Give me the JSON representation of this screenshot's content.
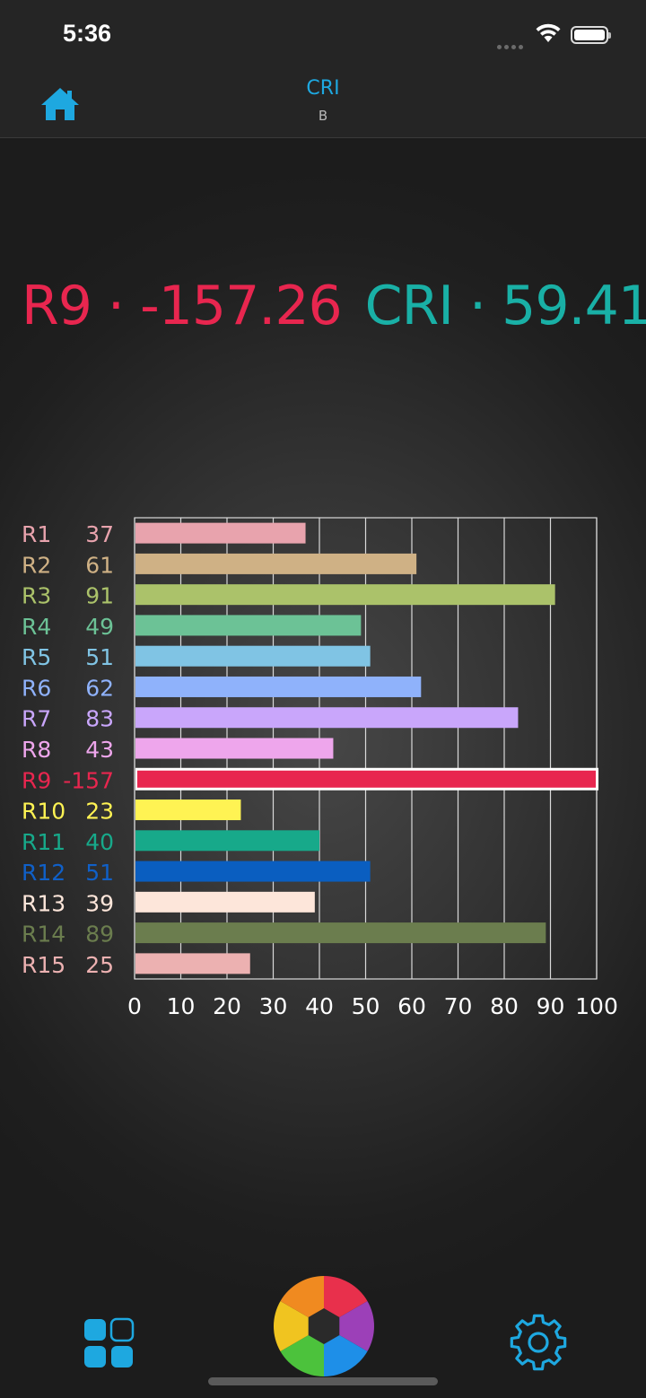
{
  "status_bar": {
    "time": "5:36"
  },
  "nav": {
    "title": "CRI",
    "subtitle": "B",
    "home_icon": "home-icon"
  },
  "headline": {
    "r9_text": "R9 · -157.26",
    "cri_text": "CRI · 59.41"
  },
  "chart_data": {
    "type": "bar",
    "orientation": "horizontal",
    "categories": [
      "R1",
      "R2",
      "R3",
      "R4",
      "R5",
      "R6",
      "R7",
      "R8",
      "R9",
      "R10",
      "R11",
      "R12",
      "R13",
      "R14",
      "R15"
    ],
    "value_labels": [
      "37",
      "61",
      "91",
      "49",
      "51",
      "62",
      "83",
      "43",
      "-157",
      "23",
      "40",
      "51",
      "39",
      "89",
      "25"
    ],
    "values": [
      37,
      61,
      91,
      49,
      51,
      62,
      83,
      43,
      -157,
      23,
      40,
      51,
      39,
      89,
      25
    ],
    "colors": [
      "#e8a3ad",
      "#cfb185",
      "#abc26a",
      "#6cc296",
      "#80c4e4",
      "#8fb2fb",
      "#c9a6fb",
      "#eea6ec",
      "#e8264f",
      "#fff353",
      "#17a98a",
      "#0a5ec0",
      "#fde6da",
      "#6b7d4e",
      "#ecb1b1"
    ],
    "label_colors": [
      "#e8a3ad",
      "#cfb185",
      "#abc26a",
      "#6cc296",
      "#80c4e4",
      "#8fb2fb",
      "#c9a6fb",
      "#eea6ec",
      "#e8264f",
      "#fff353",
      "#17a98a",
      "#1060c8",
      "#fde6da",
      "#6b7d4e",
      "#ecb1b1"
    ],
    "highlight_index": 8,
    "xticks": [
      "0",
      "10",
      "20",
      "30",
      "40",
      "50",
      "60",
      "70",
      "80",
      "90",
      "100"
    ],
    "xlim": [
      0,
      100
    ],
    "grid": true
  },
  "tab_bar": {
    "left_icon": "grid-icon",
    "center_icon": "camera-shutter-icon",
    "right_icon": "gear-icon"
  }
}
